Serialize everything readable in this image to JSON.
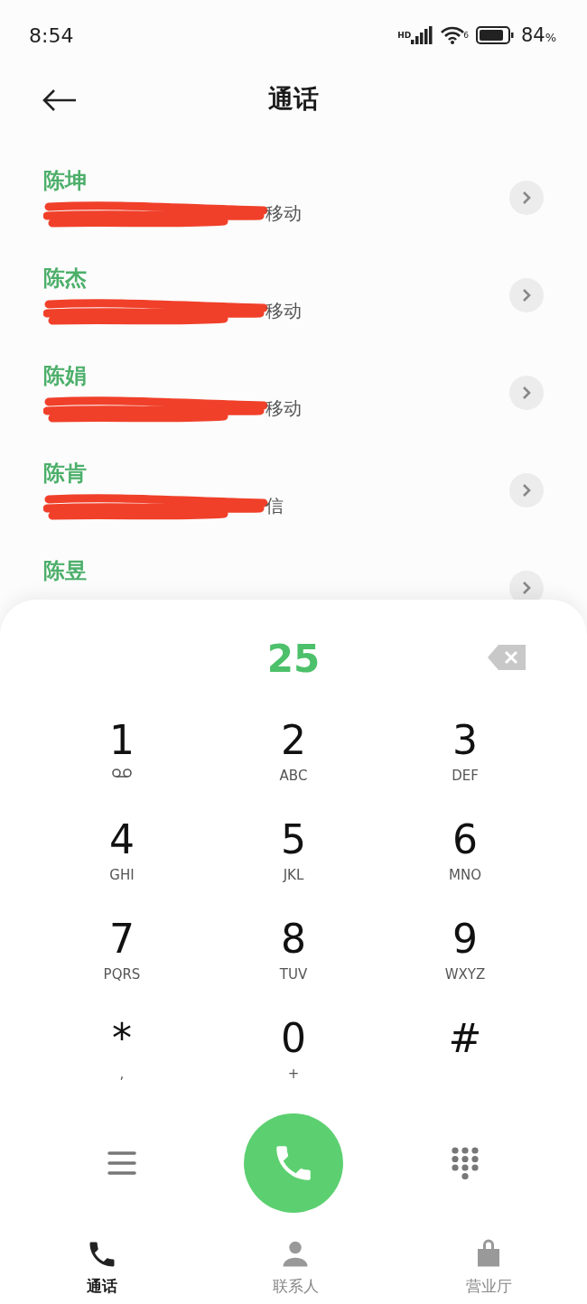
{
  "status_bar": {
    "time": "8:54",
    "signal_badge": "HD",
    "wifi_badge": "6",
    "battery": "84",
    "battery_unit": "%"
  },
  "header": {
    "title": "通话"
  },
  "contacts": [
    {
      "name": "陈坤",
      "detail": "移动"
    },
    {
      "name": "陈杰",
      "detail": "移动"
    },
    {
      "name": "陈娟",
      "detail": "移动"
    },
    {
      "name": "陈肯",
      "detail": "信"
    },
    {
      "name": "陈昱"
    }
  ],
  "dialer": {
    "input": "25",
    "keys": [
      {
        "digit": "1",
        "kind": "voicemail"
      },
      {
        "digit": "2",
        "letters": "ABC"
      },
      {
        "digit": "3",
        "letters": "DEF"
      },
      {
        "digit": "4",
        "letters": "GHI"
      },
      {
        "digit": "5",
        "letters": "JKL"
      },
      {
        "digit": "6",
        "letters": "MNO"
      },
      {
        "digit": "7",
        "letters": "PQRS"
      },
      {
        "digit": "8",
        "letters": "TUV"
      },
      {
        "digit": "9",
        "letters": "WXYZ"
      },
      {
        "digit": "*",
        "letters": ","
      },
      {
        "digit": "0",
        "letters": "+"
      },
      {
        "digit": "#"
      }
    ]
  },
  "tabs": [
    {
      "label": "通话",
      "kind": "phone",
      "selected": true
    },
    {
      "label": "联系人",
      "kind": "person",
      "selected": false
    },
    {
      "label": "营业厅",
      "kind": "store",
      "selected": false
    }
  ]
}
